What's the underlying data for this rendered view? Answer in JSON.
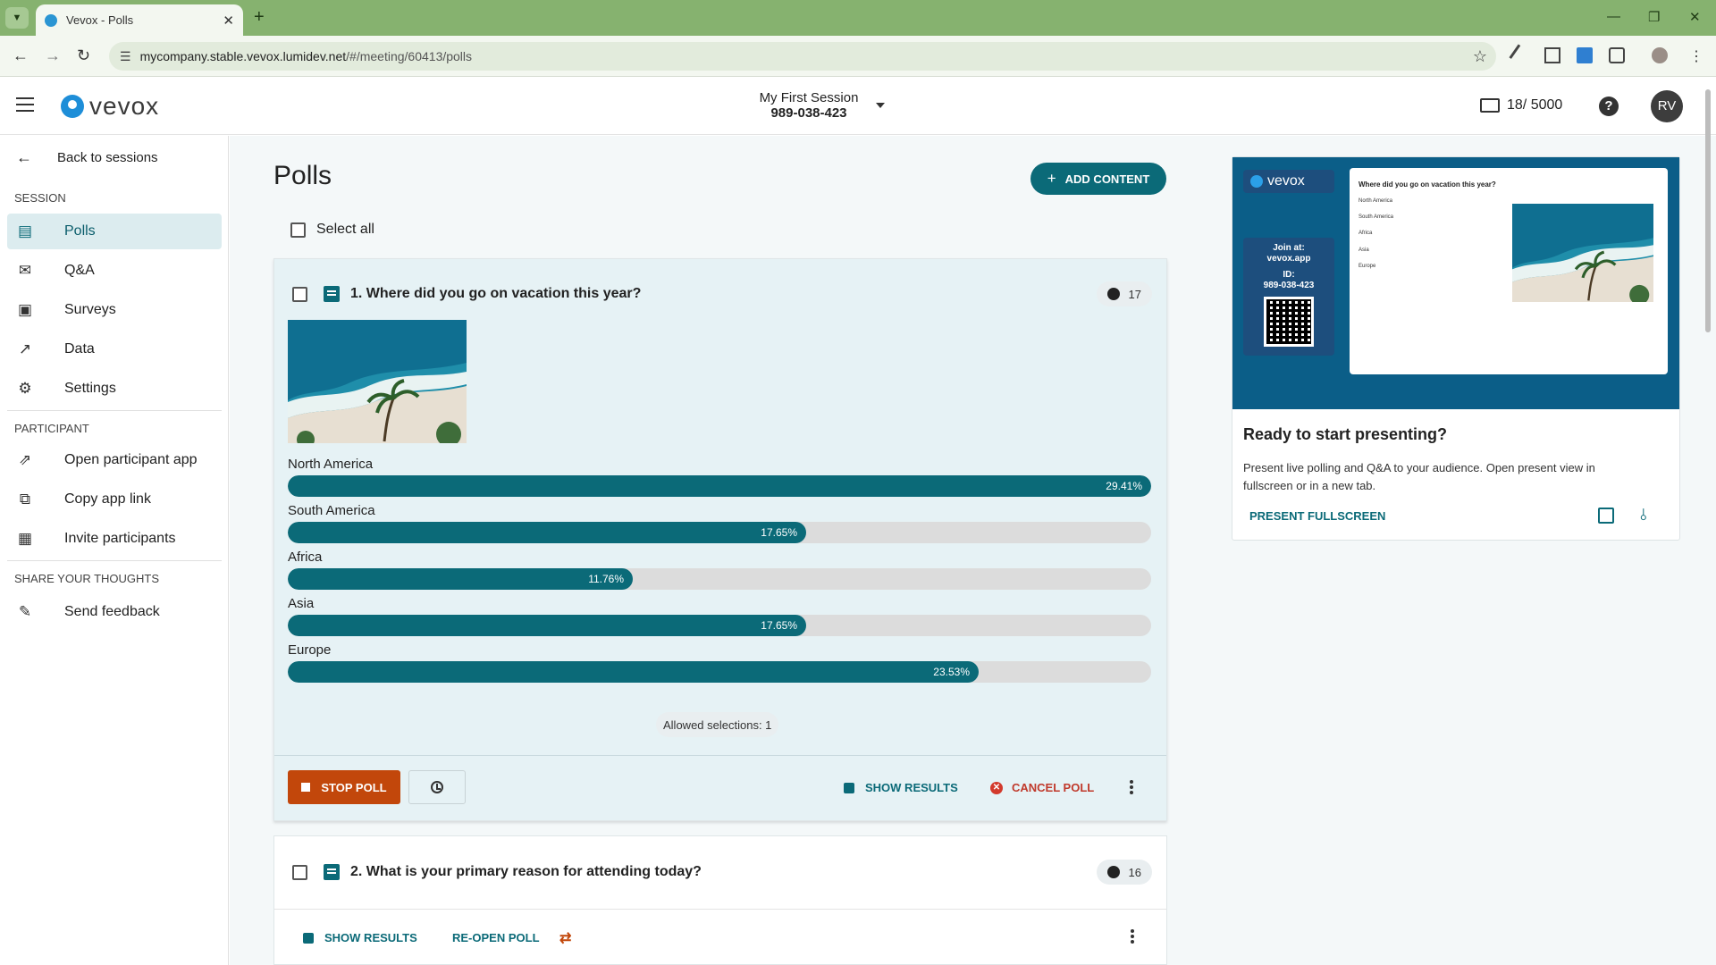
{
  "browser": {
    "tab_title": "Vevox - Polls",
    "url_host": "mycompany.stable.vevox.lumidev.net",
    "url_path": "/#/meeting/60413/polls"
  },
  "header": {
    "logo_text": "vevox",
    "session_name": "My First Session",
    "session_id": "989-038-423",
    "participant_count": "18/ 5000",
    "help_label": "?",
    "avatar_initials": "RV"
  },
  "sidebar": {
    "back_label": "Back to sessions",
    "section_session": "SESSION",
    "session_items": [
      {
        "label": "Polls",
        "icon": "poll-icon"
      },
      {
        "label": "Q&A",
        "icon": "qa-icon"
      },
      {
        "label": "Surveys",
        "icon": "survey-icon"
      },
      {
        "label": "Data",
        "icon": "chart-line-icon"
      },
      {
        "label": "Settings",
        "icon": "gear-icon"
      }
    ],
    "section_participant": "PARTICIPANT",
    "participant_items": [
      {
        "label": "Open participant app",
        "icon": "open-external-icon"
      },
      {
        "label": "Copy app link",
        "icon": "copy-icon"
      },
      {
        "label": "Invite participants",
        "icon": "calendar-icon"
      }
    ],
    "section_share": "SHARE YOUR THOUGHTS",
    "share_items": [
      {
        "label": "Send feedback",
        "icon": "feedback-icon"
      }
    ]
  },
  "main": {
    "title": "Polls",
    "add_content_label": "ADD CONTENT",
    "select_all_label": "Select all"
  },
  "poll1": {
    "question": "1. Where did you go on vacation this year?",
    "responses": "17",
    "options": [
      {
        "label": "North America",
        "pct_label": "29.41%",
        "value": 29.41
      },
      {
        "label": "South America",
        "pct_label": "17.65%",
        "value": 17.65
      },
      {
        "label": "Africa",
        "pct_label": "11.76%",
        "value": 11.76
      },
      {
        "label": "Asia",
        "pct_label": "17.65%",
        "value": 17.65
      },
      {
        "label": "Europe",
        "pct_label": "23.53%",
        "value": 23.53
      }
    ],
    "allowed_selections": "Allowed selections: 1",
    "stop_label": "STOP POLL",
    "show_results_label": "SHOW RESULTS",
    "cancel_label": "CANCEL POLL"
  },
  "poll2": {
    "question": "2. What is your primary reason for attending today?",
    "responses": "16",
    "show_results_label": "SHOW RESULTS",
    "reopen_label": "RE-OPEN POLL"
  },
  "present": {
    "preview_logo": "vevox",
    "preview_join_line1": "Join at:",
    "preview_join_line2": "vevox.app",
    "preview_id_label": "ID:",
    "preview_id": "989-038-423",
    "preview_question": "Where did you go on vacation this year?",
    "preview_options": [
      "North America",
      "South America",
      "Africa",
      "Asia",
      "Europe"
    ],
    "title": "Ready to start presenting?",
    "text": "Present live polling and Q&A to your audience. Open present view in fullscreen or in a new tab.",
    "fullscreen_label": "PRESENT FULLSCREEN"
  },
  "colors": {
    "accent": "#0b6a78",
    "stop": "#c2470b",
    "cancel": "#d33a2c",
    "chrome": "#86b26f"
  }
}
